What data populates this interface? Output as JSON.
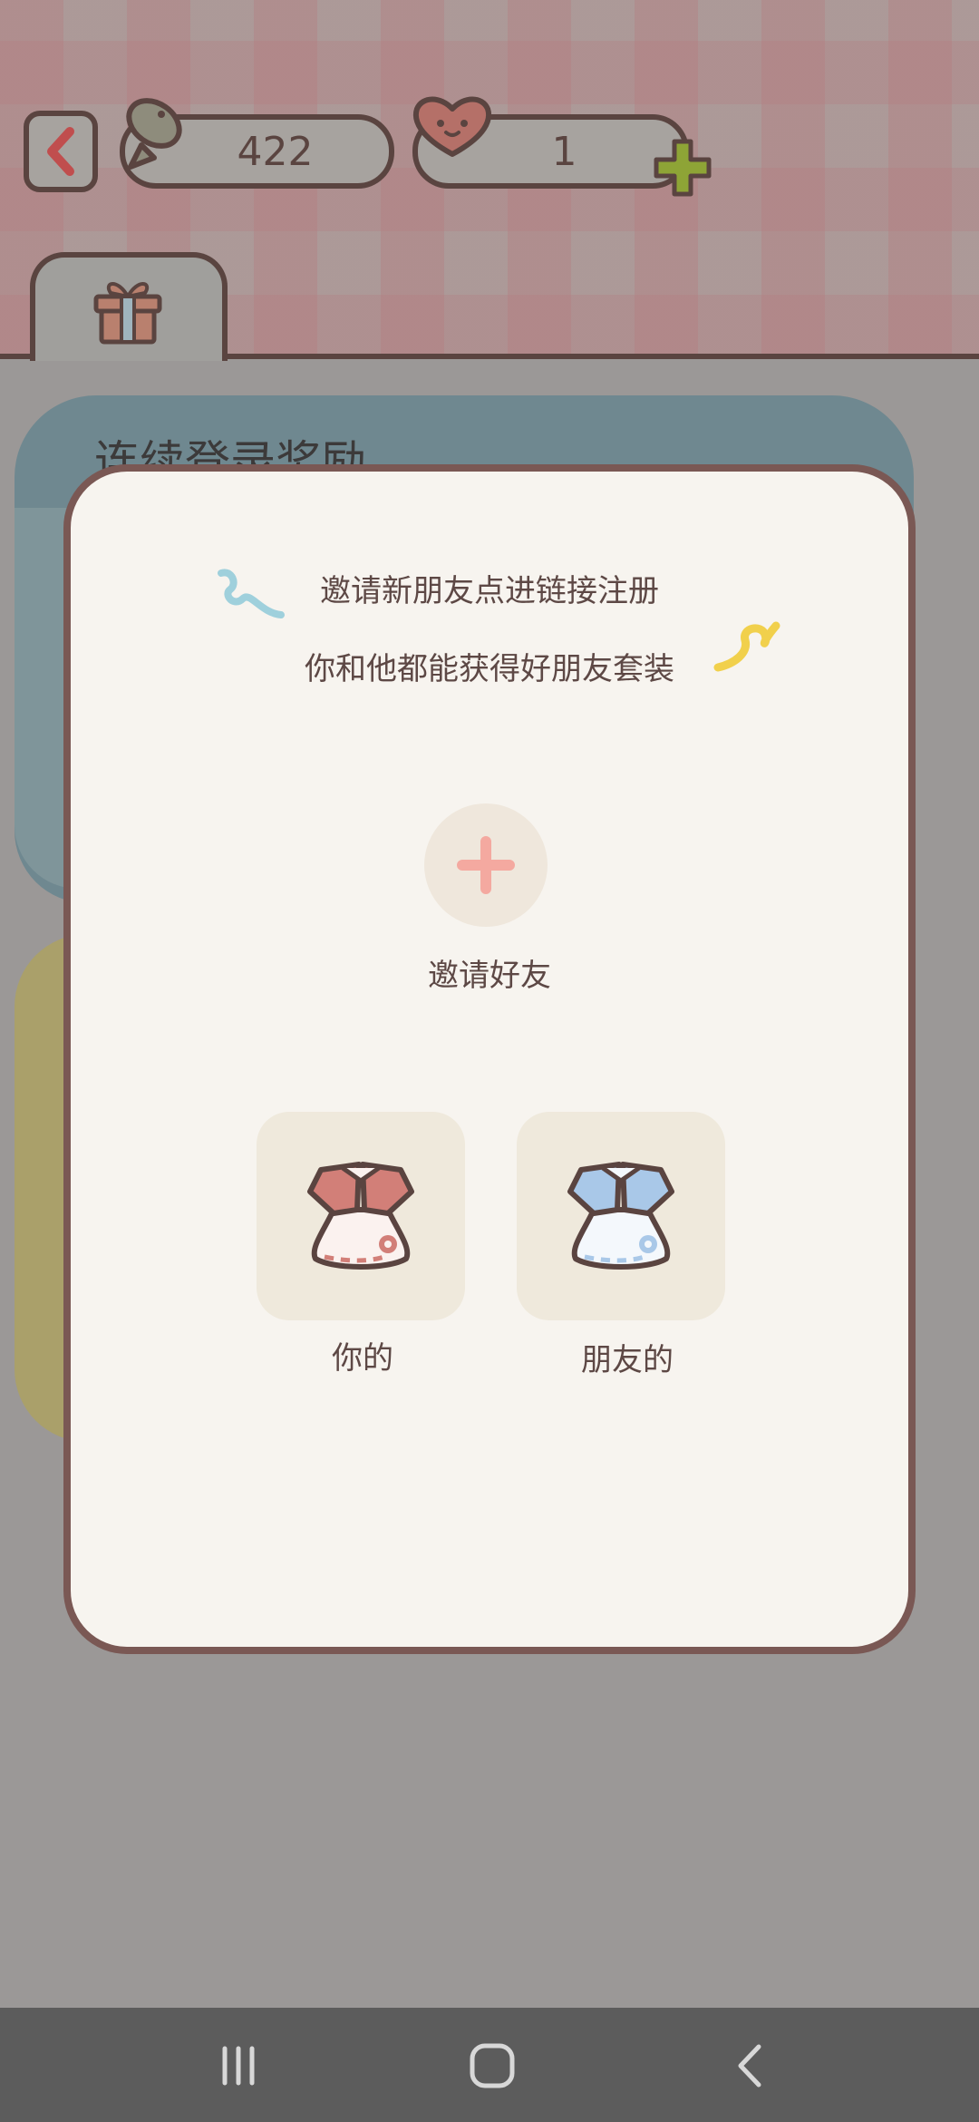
{
  "header": {
    "fish_count": "422",
    "heart_count": "1"
  },
  "background": {
    "card_title": "连续登录奖励"
  },
  "modal": {
    "line1": "邀请新朋友点进链接注册",
    "line2": "你和他都能获得好朋友套装",
    "invite_button_label": "邀请好友",
    "rewards": [
      {
        "label": "你的",
        "color": "#d27f78"
      },
      {
        "label": "朋友的",
        "color": "#a9c8e8"
      }
    ]
  },
  "colors": {
    "outline": "#5a4440",
    "modal_bg": "#f7f4ef",
    "plus_accent": "#f4a9a0",
    "green_plus": "#8ea436"
  },
  "icons": [
    "back-chevron-icon",
    "fish-icon",
    "heart-face-icon",
    "add-plus-icon",
    "gift-icon",
    "ribbon-icon",
    "dress-icon",
    "recent-apps-icon",
    "home-icon",
    "back-icon"
  ]
}
